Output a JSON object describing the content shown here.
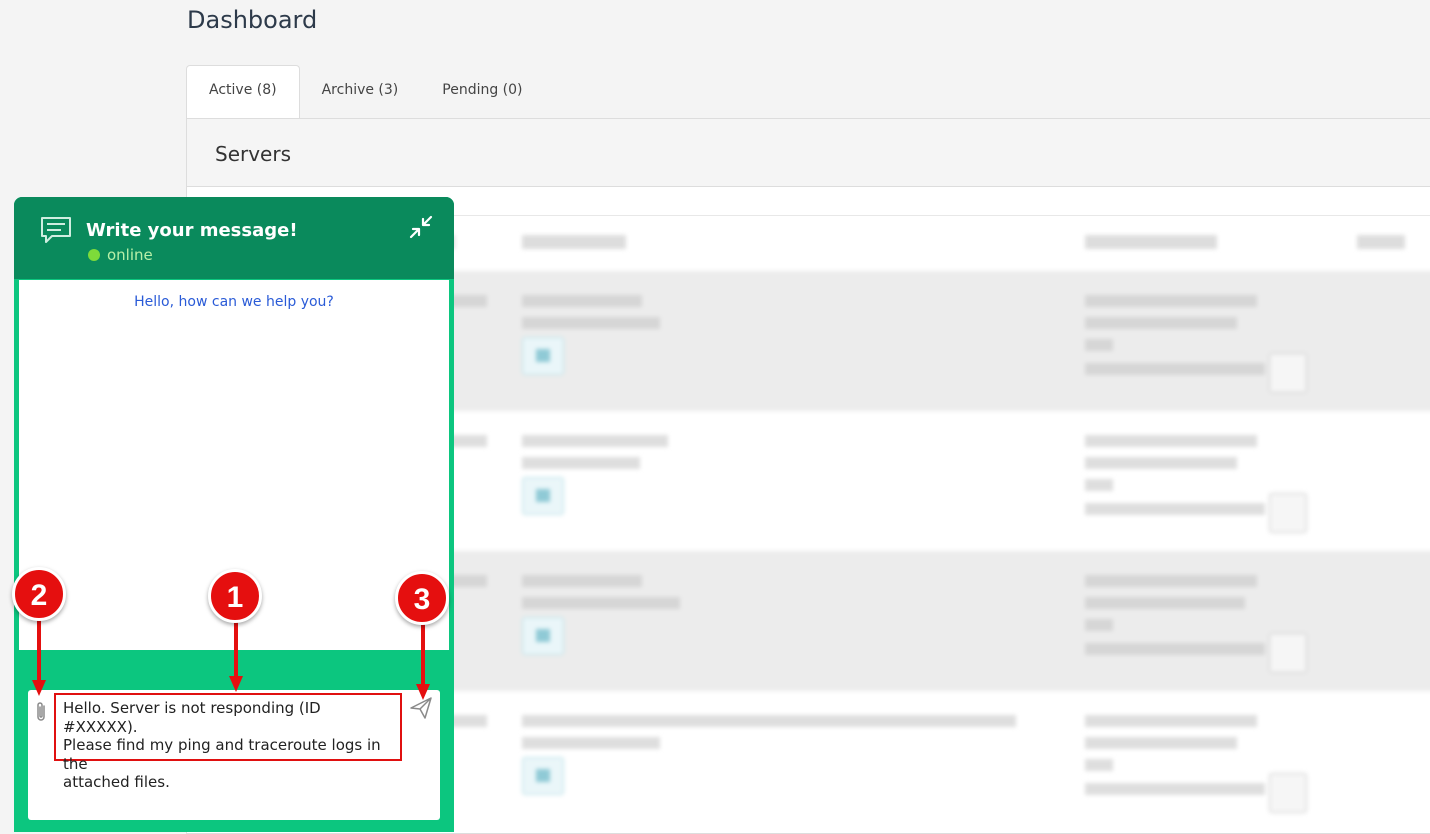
{
  "page": {
    "title": "Dashboard"
  },
  "tabs": [
    {
      "label": "Active (8)",
      "active": true
    },
    {
      "label": "Archive (3)",
      "active": false
    },
    {
      "label": "Pending (0)",
      "active": false
    }
  ],
  "panel": {
    "title": "Servers"
  },
  "colors": {
    "chat_header": "#0a8a5c",
    "chat_accent": "#0cc67f",
    "callout": "#e50f0f",
    "link": "#2a5bd7"
  },
  "chat": {
    "title": "Write your message!",
    "status": "online",
    "greeting": "Hello, how can we help you?",
    "message": "Hello. Server is not responding (ID #XXXXX).\nPlease find my ping and traceroute logs in the\nattached files.",
    "icons": {
      "chat": "chat-bubble-icon",
      "minimize": "minimize-arrows-icon",
      "attach": "paperclip-icon",
      "send": "send-icon"
    }
  },
  "callouts": [
    "1",
    "2",
    "3"
  ]
}
